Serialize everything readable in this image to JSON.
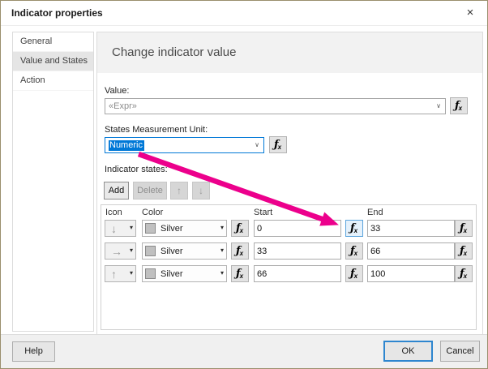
{
  "window": {
    "title": "Indicator properties"
  },
  "icons": {
    "close": "×",
    "combo_chevron": "∨",
    "dropdown_triangle": "▾",
    "fx_f": "ƒ",
    "fx_x": "x",
    "up_arrow": "↑",
    "down_arrow": "↓"
  },
  "sidebar": {
    "items": [
      {
        "label": "General"
      },
      {
        "label": "Value and States"
      },
      {
        "label": "Action"
      }
    ],
    "selected": "Value and States"
  },
  "main": {
    "header": "Change indicator value",
    "value_label": "Value:",
    "value_text": "«Expr»",
    "unit_label": "States Measurement Unit:",
    "unit_value": "Numeric",
    "states_label": "Indicator states:",
    "add_label": "Add",
    "delete_label": "Delete",
    "table": {
      "headers": {
        "icon": "Icon",
        "color": "Color",
        "start": "Start",
        "end": "End"
      },
      "rows": [
        {
          "icon": "down-arrow",
          "glyph": "↓",
          "color": "Silver",
          "start": "0",
          "end": "33"
        },
        {
          "icon": "right-arrow",
          "glyph": "→",
          "color": "Silver",
          "start": "33",
          "end": "66"
        },
        {
          "icon": "up-arrow",
          "glyph": "↑",
          "color": "Silver",
          "start": "66",
          "end": "100"
        }
      ]
    }
  },
  "footer": {
    "help": "Help",
    "ok": "OK",
    "cancel": "Cancel"
  },
  "annotation": {
    "arrow_color": "#ec008c",
    "points_at": "row-1 start expression (fx) button"
  },
  "colors": {
    "selection_blue": "#0078d7",
    "silver_swatch": "#c0c0c0",
    "fx_highlight_border": "#5ba4dc",
    "fx_highlight_bg": "#e5f1fb",
    "arrow_pink": "#ec008c"
  }
}
